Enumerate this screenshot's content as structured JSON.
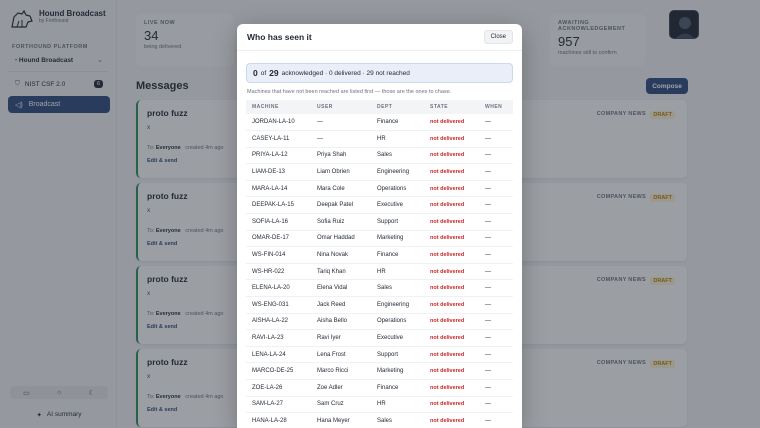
{
  "brand": {
    "name": "Hound Broadcast",
    "sub": "by Forthound"
  },
  "sidebar": {
    "platform_label": "FORTHOUND PLATFORM",
    "org": "Hound Broadcast",
    "framework": "NIST CSF 2.0",
    "framework_badge": "6",
    "nav_broadcast": "Broadcast",
    "ai_summary": "AI summary"
  },
  "stats": [
    {
      "label": "LIVE NOW",
      "value": "34",
      "sub": "being delivered"
    },
    {
      "label": "AWAITING ACKNOWLEDGEMENT",
      "value": "957",
      "sub": "machines still to confirm"
    }
  ],
  "main": {
    "title": "Messages",
    "compose": "Compose"
  },
  "cards": [
    {
      "title": "proto fuzz",
      "body": "x",
      "to_label": "To:",
      "audience": "Everyone",
      "created": "created 4m ago",
      "link": "Edit & send",
      "category": "COMPANY NEWS",
      "status": "DRAFT"
    },
    {
      "title": "proto fuzz",
      "body": "x",
      "to_label": "To:",
      "audience": "Everyone",
      "created": "created 4m ago",
      "link": "Edit & send",
      "category": "COMPANY NEWS",
      "status": "DRAFT"
    },
    {
      "title": "proto fuzz",
      "body": "x",
      "to_label": "To:",
      "audience": "Everyone",
      "created": "created 4m ago",
      "link": "Edit & send",
      "category": "COMPANY NEWS",
      "status": "DRAFT"
    },
    {
      "title": "proto fuzz",
      "body": "x",
      "to_label": "To:",
      "audience": "Everyone",
      "created": "created 4m ago",
      "link": "Edit & send",
      "category": "COMPANY NEWS",
      "status": "DRAFT"
    }
  ],
  "modal": {
    "title": "Who has seen it",
    "close": "Close",
    "ack_count": "0",
    "of_label": "of",
    "total": "29",
    "ack_text": "acknowledged · 0 delivered · 29 not reached",
    "note": "Machines that have not been reached are listed first — those are the ones to chase.",
    "columns": [
      "MACHINE",
      "USER",
      "DEPT",
      "STATE",
      "WHEN"
    ],
    "rows": [
      [
        "JORDAN-LA-10",
        "—",
        "Finance",
        "not delivered",
        "—"
      ],
      [
        "CASEY-LA-11",
        "—",
        "HR",
        "not delivered",
        "—"
      ],
      [
        "PRIYA-LA-12",
        "Priya Shah",
        "Sales",
        "not delivered",
        "—"
      ],
      [
        "LIAM-DE-13",
        "Liam Obrien",
        "Engineering",
        "not delivered",
        "—"
      ],
      [
        "MARA-LA-14",
        "Mara Cole",
        "Operations",
        "not delivered",
        "—"
      ],
      [
        "DEEPAK-LA-15",
        "Deepak Patel",
        "Executive",
        "not delivered",
        "—"
      ],
      [
        "SOFIA-LA-16",
        "Sofia Ruiz",
        "Support",
        "not delivered",
        "—"
      ],
      [
        "OMAR-DE-17",
        "Omar Haddad",
        "Marketing",
        "not delivered",
        "—"
      ],
      [
        "WS-FIN-014",
        "Nina Novak",
        "Finance",
        "not delivered",
        "—"
      ],
      [
        "WS-HR-022",
        "Tariq Khan",
        "HR",
        "not delivered",
        "—"
      ],
      [
        "ELENA-LA-20",
        "Elena Vidal",
        "Sales",
        "not delivered",
        "—"
      ],
      [
        "WS-ENG-031",
        "Jack Reed",
        "Engineering",
        "not delivered",
        "—"
      ],
      [
        "AISHA-LA-22",
        "Aisha Bello",
        "Operations",
        "not delivered",
        "—"
      ],
      [
        "RAVI-LA-23",
        "Ravi Iyer",
        "Executive",
        "not delivered",
        "—"
      ],
      [
        "LENA-LA-24",
        "Lena Frost",
        "Support",
        "not delivered",
        "—"
      ],
      [
        "MARCO-DE-25",
        "Marco Ricci",
        "Marketing",
        "not delivered",
        "—"
      ],
      [
        "ZOE-LA-26",
        "Zoe Adler",
        "Finance",
        "not delivered",
        "—"
      ],
      [
        "SAM-LA-27",
        "Sam Cruz",
        "HR",
        "not delivered",
        "—"
      ],
      [
        "HANA-LA-28",
        "Hana Meyer",
        "Sales",
        "not delivered",
        "—"
      ]
    ]
  }
}
